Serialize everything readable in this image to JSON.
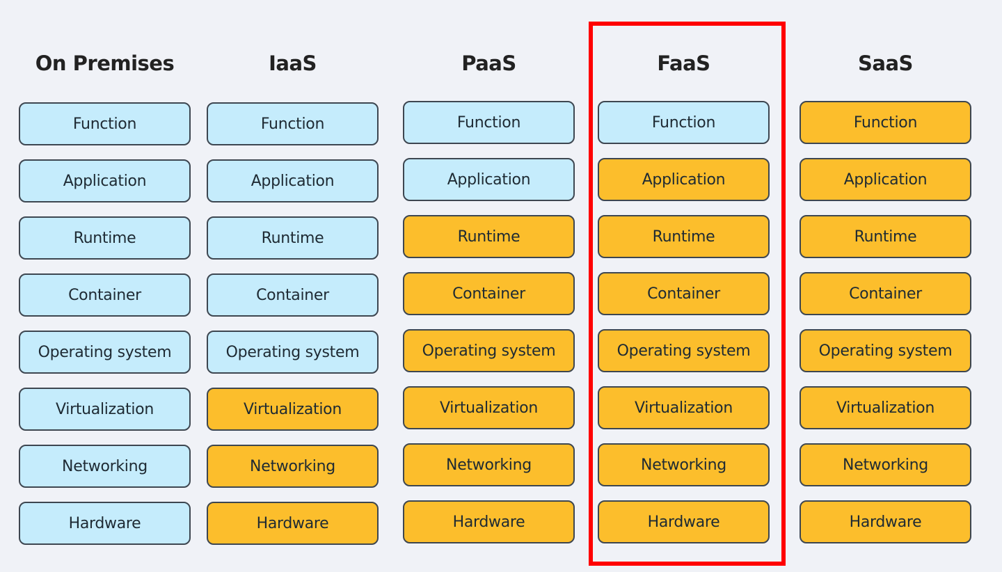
{
  "colors": {
    "customer_managed": "#c5ecfc",
    "provider_managed": "#fcbe2c",
    "highlight": "#ff0000",
    "background": "#f0f2f7"
  },
  "highlighted_column": "FaaS",
  "columns": [
    {
      "title": "On Premises",
      "layers": [
        {
          "label": "Function",
          "managed": "customer"
        },
        {
          "label": "Application",
          "managed": "customer"
        },
        {
          "label": "Runtime",
          "managed": "customer"
        },
        {
          "label": "Container",
          "managed": "customer"
        },
        {
          "label": "Operating system",
          "managed": "customer"
        },
        {
          "label": "Virtualization",
          "managed": "customer"
        },
        {
          "label": "Networking",
          "managed": "customer"
        },
        {
          "label": "Hardware",
          "managed": "customer"
        }
      ]
    },
    {
      "title": "IaaS",
      "layers": [
        {
          "label": "Function",
          "managed": "customer"
        },
        {
          "label": "Application",
          "managed": "customer"
        },
        {
          "label": "Runtime",
          "managed": "customer"
        },
        {
          "label": "Container",
          "managed": "customer"
        },
        {
          "label": "Operating system",
          "managed": "customer"
        },
        {
          "label": "Virtualization",
          "managed": "provider"
        },
        {
          "label": "Networking",
          "managed": "provider"
        },
        {
          "label": "Hardware",
          "managed": "provider"
        }
      ]
    },
    {
      "title": "PaaS",
      "layers": [
        {
          "label": "Function",
          "managed": "customer"
        },
        {
          "label": "Application",
          "managed": "customer"
        },
        {
          "label": "Runtime",
          "managed": "provider"
        },
        {
          "label": "Container",
          "managed": "provider"
        },
        {
          "label": "Operating system",
          "managed": "provider"
        },
        {
          "label": "Virtualization",
          "managed": "provider"
        },
        {
          "label": "Networking",
          "managed": "provider"
        },
        {
          "label": "Hardware",
          "managed": "provider"
        }
      ]
    },
    {
      "title": "FaaS",
      "layers": [
        {
          "label": "Function",
          "managed": "customer"
        },
        {
          "label": "Application",
          "managed": "provider"
        },
        {
          "label": "Runtime",
          "managed": "provider"
        },
        {
          "label": "Container",
          "managed": "provider"
        },
        {
          "label": "Operating system",
          "managed": "provider"
        },
        {
          "label": "Virtualization",
          "managed": "provider"
        },
        {
          "label": "Networking",
          "managed": "provider"
        },
        {
          "label": "Hardware",
          "managed": "provider"
        }
      ]
    },
    {
      "title": "SaaS",
      "layers": [
        {
          "label": "Function",
          "managed": "provider"
        },
        {
          "label": "Application",
          "managed": "provider"
        },
        {
          "label": "Runtime",
          "managed": "provider"
        },
        {
          "label": "Container",
          "managed": "provider"
        },
        {
          "label": "Operating system",
          "managed": "provider"
        },
        {
          "label": "Virtualization",
          "managed": "provider"
        },
        {
          "label": "Networking",
          "managed": "provider"
        },
        {
          "label": "Hardware",
          "managed": "provider"
        }
      ]
    }
  ]
}
